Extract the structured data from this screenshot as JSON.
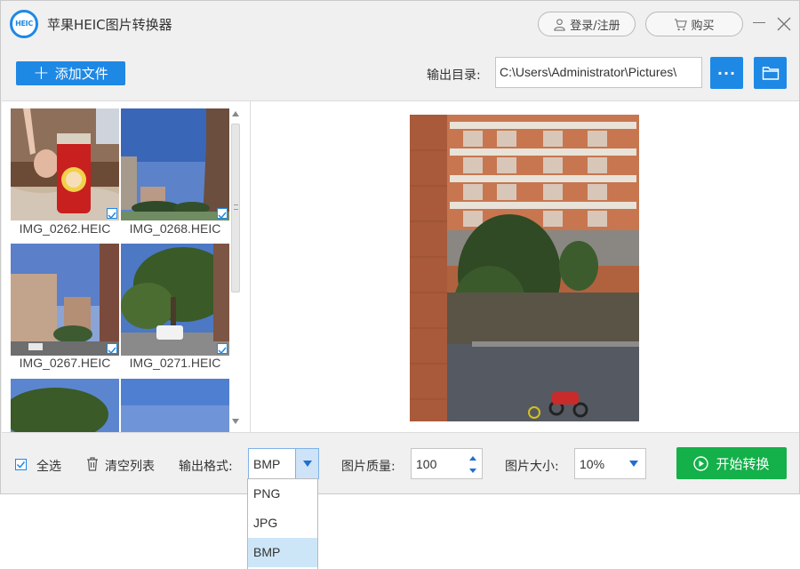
{
  "app": {
    "title": "苹果HEIC图片转换器",
    "logo_text": "HEIC"
  },
  "header": {
    "login_label": "登录/注册",
    "buy_label": "购买"
  },
  "toolbar": {
    "add_label": "添加文件",
    "output_label": "输出目录:",
    "output_path": "C:\\Users\\Administrator\\Pictures\\"
  },
  "files": [
    {
      "name": "IMG_0262.HEIC",
      "checked": true
    },
    {
      "name": "IMG_0268.HEIC",
      "checked": true
    },
    {
      "name": "IMG_0267.HEIC",
      "checked": true
    },
    {
      "name": "IMG_0271.HEIC",
      "checked": true
    }
  ],
  "bottom": {
    "select_all_label": "全选",
    "clear_label": "清空列表",
    "format_label": "输出格式:",
    "format_value": "BMP",
    "quality_label": "图片质量:",
    "quality_value": "100",
    "size_label": "图片大小:",
    "size_value": "10%",
    "start_label": "开始转换"
  },
  "format_options": [
    "PNG",
    "JPG",
    "BMP"
  ],
  "colors": {
    "accent": "#1e88e5",
    "start": "#14b04a",
    "selected_option": "#cde6f7"
  }
}
